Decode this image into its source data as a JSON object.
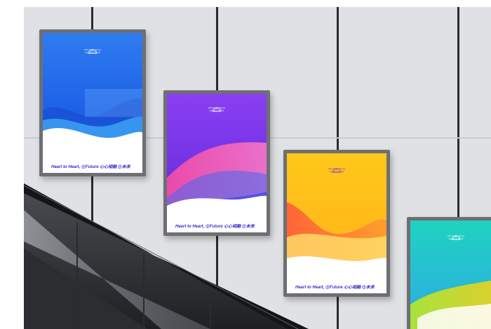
{
  "scene": {
    "description_colors": {
      "wall": "#dfe1e4",
      "seam": "#2a2b2e",
      "frame": "#6e6f73"
    }
  },
  "posters": [
    {
      "slogan": "Heart to Heart, @Future  心心相融 @未来",
      "emblem_title": "19th Asian Games",
      "emblem_city": "Hangzhou 2022",
      "theme": "blue",
      "slogan_color": "#3a2bd1"
    },
    {
      "slogan": "Heart to Heart, @Future  心心相融 @未来",
      "emblem_title": "19th Asian Games",
      "emblem_city": "Hangzhou 2022",
      "theme": "purple",
      "slogan_color": "#3a2bd1"
    },
    {
      "slogan": "Heart to Heart, @Future  心心相融 @未来",
      "emblem_title": "19th Asian Games",
      "emblem_city": "Hangzhou 2022",
      "theme": "yellow",
      "slogan_color": "#3a2bd1"
    },
    {
      "slogan": "",
      "emblem_title": "19th Asian Games",
      "emblem_city": "Hangzhou 2022",
      "theme": "teal",
      "slogan_color": "#3a2bd1"
    }
  ]
}
